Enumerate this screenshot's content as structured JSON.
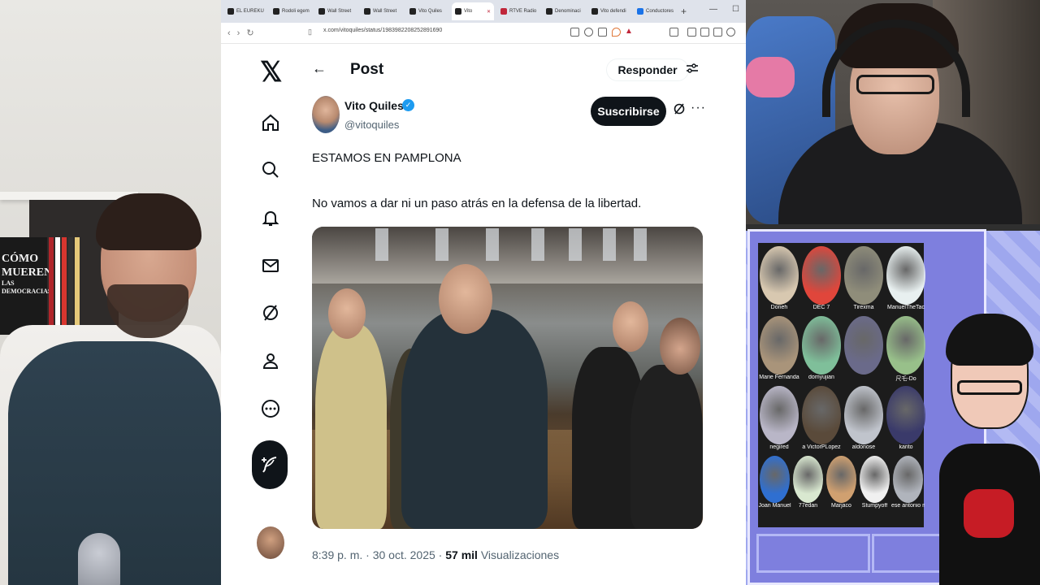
{
  "browser": {
    "tabs": [
      {
        "label": "EL EUREKU"
      },
      {
        "label": "Rodoli egem"
      },
      {
        "label": "Wall Street"
      },
      {
        "label": "Wall Street"
      },
      {
        "label": "Vito Quiles"
      },
      {
        "label": "Vito"
      },
      {
        "label": "RTVE Radio"
      },
      {
        "label": "Denominaci"
      },
      {
        "label": "Vito defendi"
      },
      {
        "label": "Conductores"
      }
    ],
    "new_tab": "+",
    "url": "x.com/vitoquiles/status/1983982208252891690"
  },
  "x_sidebar": {
    "logo": "𝕏",
    "items": [
      "home-icon",
      "search-icon",
      "bell-icon",
      "mail-icon",
      "grok-icon",
      "profile-icon",
      "more-circle-icon"
    ],
    "compose_icon": "feather-plus-icon"
  },
  "post": {
    "header_title": "Post",
    "reply_label": "Responder",
    "author_name": "Vito Quiles",
    "author_handle": "@vitoquiles",
    "subscribe_label": "Suscribirse",
    "more": "···",
    "text_line1": "ESTAMOS EN PAMPLONA",
    "text_line2": "No vamos a dar ni un paso atrás en la defensa de la libertad.",
    "time": "8:39 p. m.",
    "separator": "·",
    "date": "30 oct. 2025",
    "separator2": "·",
    "views_count": "57 mil",
    "views_label": "Visualizaciones"
  },
  "book": {
    "line1": "CÓMO",
    "line2": "MUEREN",
    "line3": "LAS",
    "line4": "DEMOCRACIAS"
  },
  "overlay": {
    "cells": [
      {
        "name": "Doneh",
        "color": "#d8c8b0"
      },
      {
        "name": "DEC 7",
        "color": "#e0463b"
      },
      {
        "name": "Tirexma",
        "color": "#8f8d7a"
      },
      {
        "name": "ManuelTheTac",
        "color": "#e8f0f0"
      },
      {
        "name": "Marie Fernanda",
        "color": "#a9947a"
      },
      {
        "name": "domyujian",
        "color": "#7fbf9a"
      },
      {
        "name": "",
        "color": "#6a6a8a"
      },
      {
        "name": "尺乇-Do",
        "color": "#98c08a"
      },
      {
        "name": "negired",
        "color": "#b9b6c7"
      },
      {
        "name": "a VictorPLopez",
        "color": "#5a4a3a"
      },
      {
        "name": "aldonose",
        "color": "#c0c4cc"
      },
      {
        "name": "karito",
        "color": "#3a3a6a"
      },
      {
        "name": "Joan Manuel",
        "color": "#2f6fd1"
      },
      {
        "name": "77edan",
        "color": "#d9e8d0"
      },
      {
        "name": "Marjaco",
        "color": "#d0a070"
      },
      {
        "name": "Stumpyoff",
        "color": "#f0f0f0"
      },
      {
        "name": "ese antonio martin",
        "color": "#b0b4bc"
      }
    ]
  }
}
